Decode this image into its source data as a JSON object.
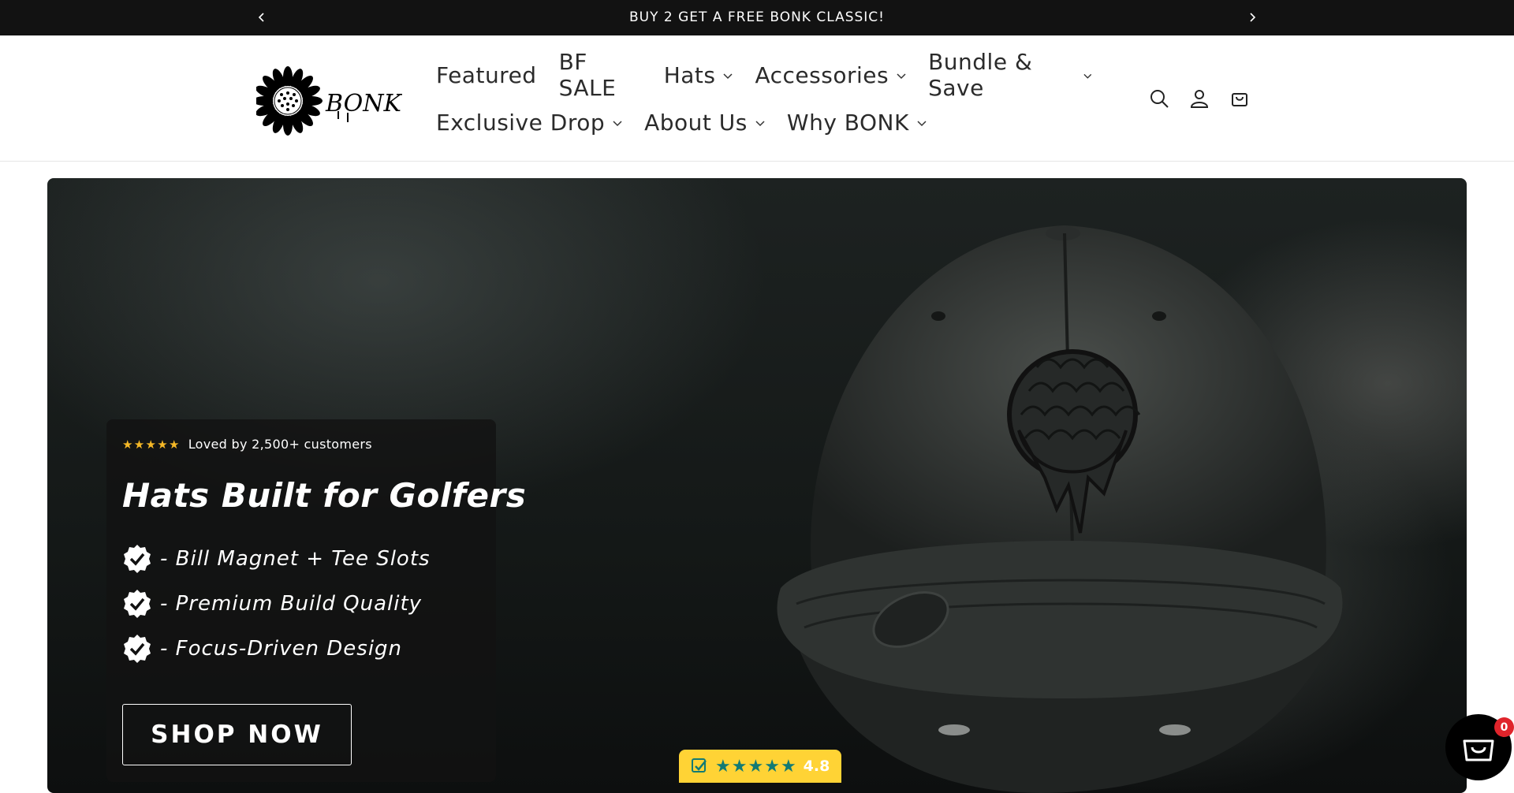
{
  "announcement": {
    "text": "BUY 2 GET A FREE BONK CLASSIC!",
    "prev_icon": "chevron-left-icon",
    "next_icon": "chevron-right-icon"
  },
  "header": {
    "logo_text": "BONK",
    "nav_row1": [
      {
        "label": "Featured",
        "has_dropdown": false
      },
      {
        "label": "BF SALE",
        "has_dropdown": false
      },
      {
        "label": "Hats",
        "has_dropdown": true
      },
      {
        "label": "Accessories",
        "has_dropdown": true
      },
      {
        "label": "Bundle & Save",
        "has_dropdown": true
      }
    ],
    "nav_row2": [
      {
        "label": "Exclusive Drop",
        "has_dropdown": true
      },
      {
        "label": "About Us",
        "has_dropdown": true
      },
      {
        "label": "Why BONK",
        "has_dropdown": true
      }
    ],
    "icons": [
      "search-icon",
      "account-icon",
      "cart-icon"
    ]
  },
  "hero": {
    "rating_text": "Loved by 2,500+ customers",
    "rating_stars": 5,
    "title": "Hats Built for Golfers",
    "features": [
      "- Bill Magnet + Tee Slots",
      "- Premium Build Quality",
      "- Focus-Driven Design"
    ],
    "cta_label": "SHOP NOW"
  },
  "review_widget": {
    "score": "4.8",
    "stars": 5
  },
  "floating_cart": {
    "count": "0"
  },
  "colors": {
    "star_gold": "#f5b827",
    "review_bg": "#ffd335",
    "review_star": "#127a74",
    "badge_red": "#e0242b"
  }
}
